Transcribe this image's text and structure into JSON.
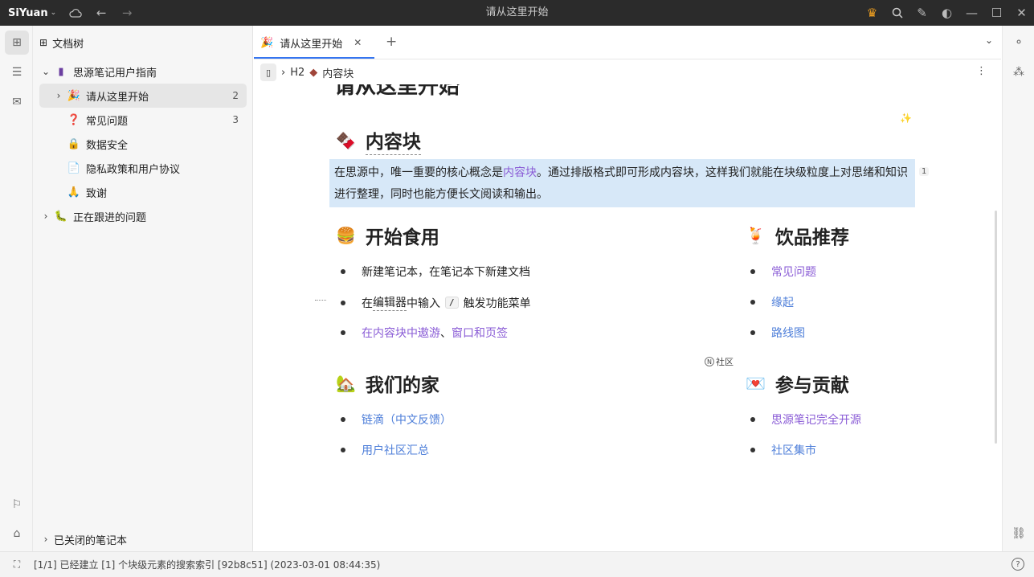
{
  "titlebar": {
    "app_name": "SiYuan",
    "window_title": "请从这里开始"
  },
  "filetree": {
    "title": "文档树",
    "notebook": "思源笔记用户指南",
    "items": [
      {
        "label": "请从这里开始",
        "count": "2",
        "emoji": "🎉"
      },
      {
        "label": "常见问题",
        "count": "3",
        "emoji": "❓"
      },
      {
        "label": "数据安全",
        "count": "",
        "emoji": "🔒"
      },
      {
        "label": "隐私政策和用户协议",
        "count": "",
        "emoji": "📄"
      },
      {
        "label": "致谢",
        "count": "",
        "emoji": "🙏"
      }
    ],
    "notebook2": "正在跟进的问题",
    "closed_notebooks": "已关闭的笔记本"
  },
  "tab": {
    "label": "请从这里开始"
  },
  "breadcrumb": {
    "level": "H2",
    "label": "内容块"
  },
  "doc": {
    "title": "请从这里开始",
    "h_content": "内容块",
    "para_before": "在思源中，唯一重要的核心概念是",
    "para_link": "内容块",
    "para_after": "。通过排版格式即可形成内容块，这样我们就能在块级粒度上对思绪和知识进行整理，同时也能方便长文阅读和输出。",
    "para_ref": "1",
    "h_start": "开始食用",
    "start_items": {
      "item1": "新建笔记本，在笔记本下新建文档",
      "item2_a": "在",
      "item2_b": "编辑器",
      "item2_c": "中输入",
      "item2_kbd": "/",
      "item2_d": "触发功能菜单",
      "item3_a": "在内容块中遨游",
      "item3_sep": "、",
      "item3_b": "窗口和页签"
    },
    "h_drinks": "饮品推荐",
    "drinks_items": [
      "常见问题",
      "缘起",
      "路线图"
    ],
    "community_label": "社区",
    "h_home": "我们的家",
    "home_items": [
      "链滴（中文反馈）",
      "用户社区汇总"
    ],
    "h_contrib": "参与贡献",
    "contrib_items": [
      "思源笔记完全开源",
      "社区集市"
    ]
  },
  "statusbar": {
    "text": "[1/1] 已经建立 [1] 个块级元素的搜索索引 [92b8c51] (2023-03-01 08:44:35)"
  },
  "colors": {
    "accent": "#3575f0",
    "link_purple": "#8a5cd6",
    "link_blue": "#4d7ed9",
    "highlight": "#d7e8f8"
  }
}
